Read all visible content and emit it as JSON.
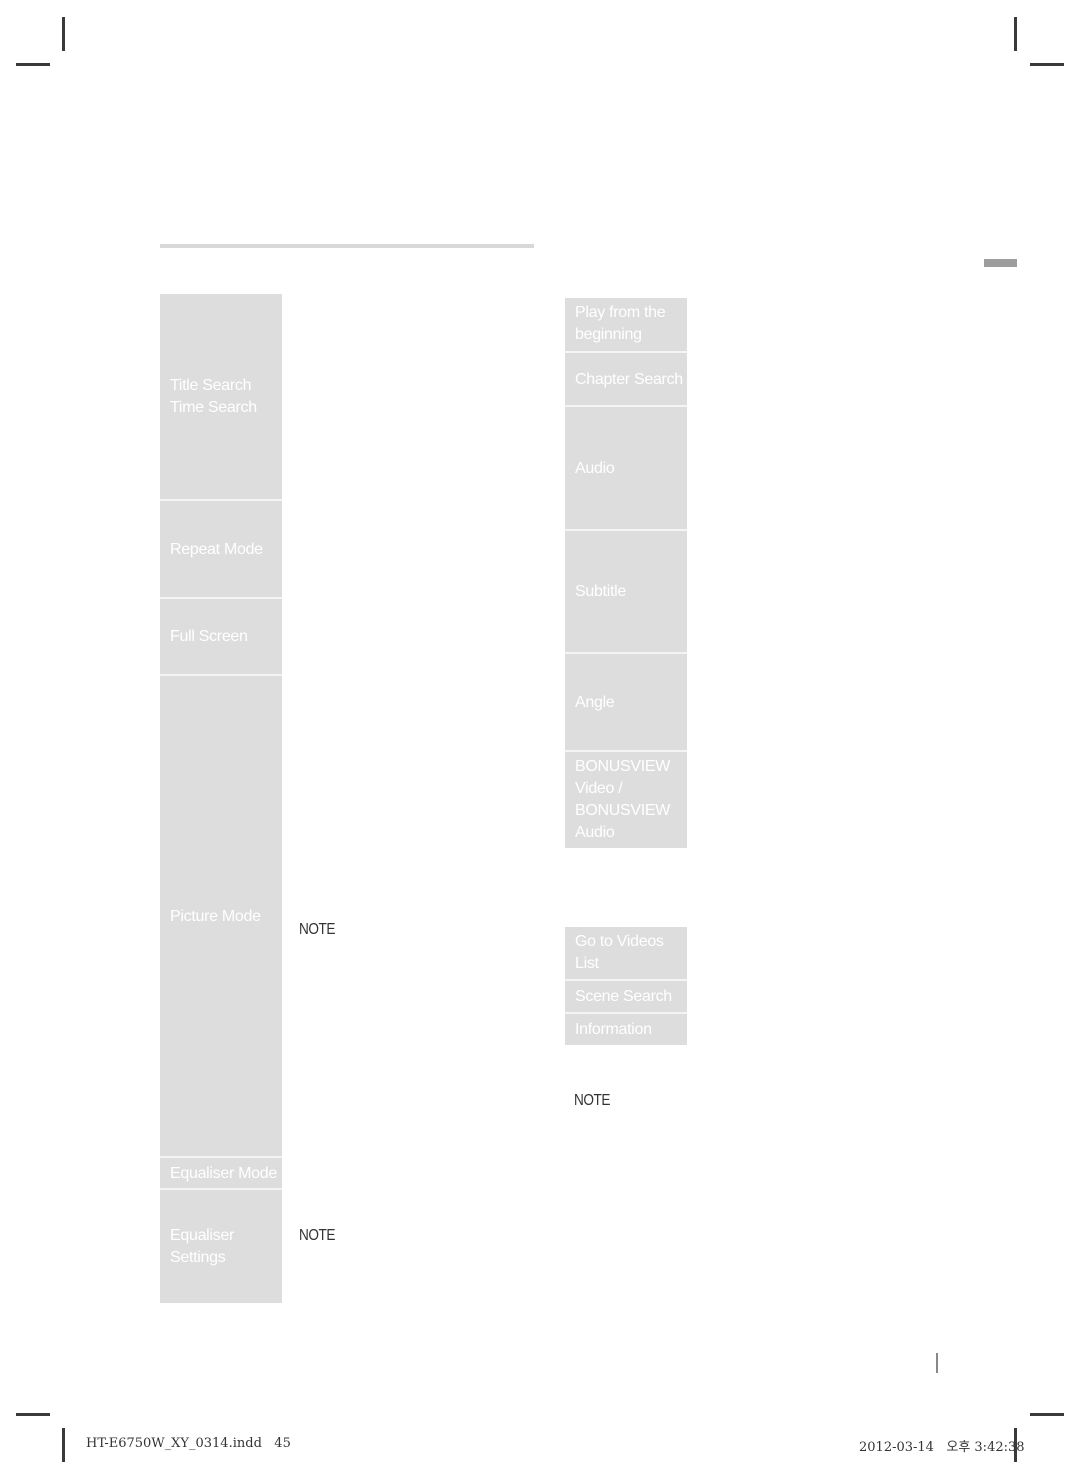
{
  "left_table": {
    "rows": [
      {
        "label": "Title Search\nTime Search"
      },
      {
        "label": "Repeat Mode"
      },
      {
        "label": "Full Screen"
      },
      {
        "label": "Picture Mode"
      },
      {
        "label": "Equaliser Mode"
      },
      {
        "label": "Equaliser\nSettings"
      }
    ]
  },
  "left_notes": [
    "NOTE",
    "NOTE"
  ],
  "right_table_1": {
    "rows": [
      {
        "label": "Play from the\nbeginning"
      },
      {
        "label": "Chapter Search"
      },
      {
        "label": "Audio"
      },
      {
        "label": "Subtitle"
      },
      {
        "label": "Angle"
      },
      {
        "label": "BONUSVIEW\nVideo /\nBONUSVIEW\nAudio"
      }
    ]
  },
  "right_table_2": {
    "rows": [
      {
        "label": "Go to Videos\nList"
      },
      {
        "label": "Scene Search"
      },
      {
        "label": "Information"
      }
    ]
  },
  "right_note": "NOTE",
  "footer": {
    "file_name": "HT-E6750W_XY_0314.indd",
    "page_number": "45",
    "date": "2012-03-14",
    "time": "오후 3:42:38"
  },
  "colors": {
    "cell_background": "#dddddd",
    "cell_text": "#ffffff",
    "note_text": "#333333",
    "rule": "#d8d8d8",
    "tab_marker": "#9d9d9d"
  }
}
